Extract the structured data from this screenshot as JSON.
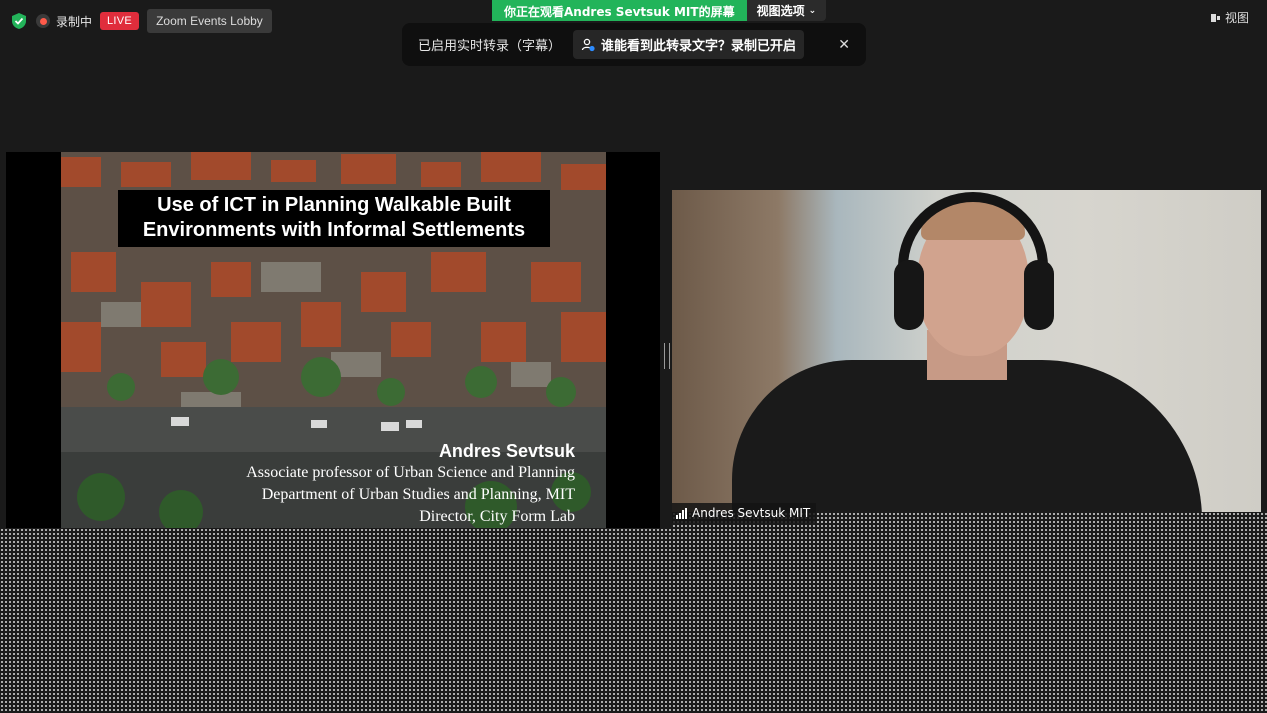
{
  "topbar": {
    "recording_label": "录制中",
    "live_label": "LIVE",
    "lobby_label": "Zoom Events Lobby",
    "share_banner": "你正在观看Andres Sevtsuk MIT的屏幕",
    "view_options_label": "视图选项",
    "view_label": "视图"
  },
  "caption_notice": {
    "text": "已启用实时转录（字幕）",
    "who_can_see": "谁能看到此转录文字？录制已开启",
    "close_label": "✕"
  },
  "slide": {
    "title_line1": "Use of ICT in Planning Walkable Built",
    "title_line2": "Environments with Informal Settlements",
    "presenter_name": "Andres Sevtsuk",
    "line1": "Associate professor of Urban Science and Planning",
    "line2": "Department of Urban Studies and Planning, MIT",
    "line3": "Director, City Form Lab"
  },
  "video": {
    "participant_name": "Andres Sevtsuk MIT"
  },
  "colors": {
    "share_green": "#22b45a",
    "live_red": "#e02d3c",
    "background": "#1a1a1a"
  }
}
